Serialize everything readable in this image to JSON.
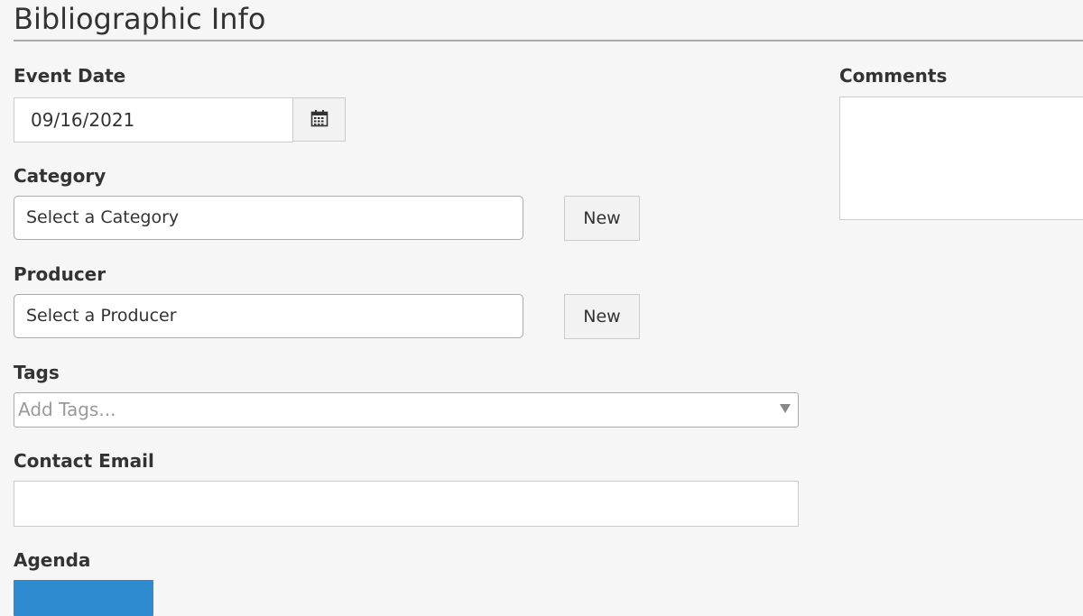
{
  "section": {
    "title": "Bibliographic Info"
  },
  "event_date": {
    "label": "Event Date",
    "value": "09/16/2021",
    "calendar_icon": "calendar-icon"
  },
  "category": {
    "label": "Category",
    "placeholder": "Select a Category",
    "new_label": "New"
  },
  "producer": {
    "label": "Producer",
    "placeholder": "Select a Producer",
    "new_label": "New"
  },
  "tags": {
    "label": "Tags",
    "placeholder": "Add Tags..."
  },
  "contact_email": {
    "label": "Contact Email",
    "value": ""
  },
  "agenda": {
    "label": "Agenda"
  },
  "comments": {
    "label": "Comments",
    "value": ""
  },
  "colors": {
    "background": "#f6f6f6",
    "accent": "#2f8bd0",
    "rule": "#a9a9a9"
  }
}
